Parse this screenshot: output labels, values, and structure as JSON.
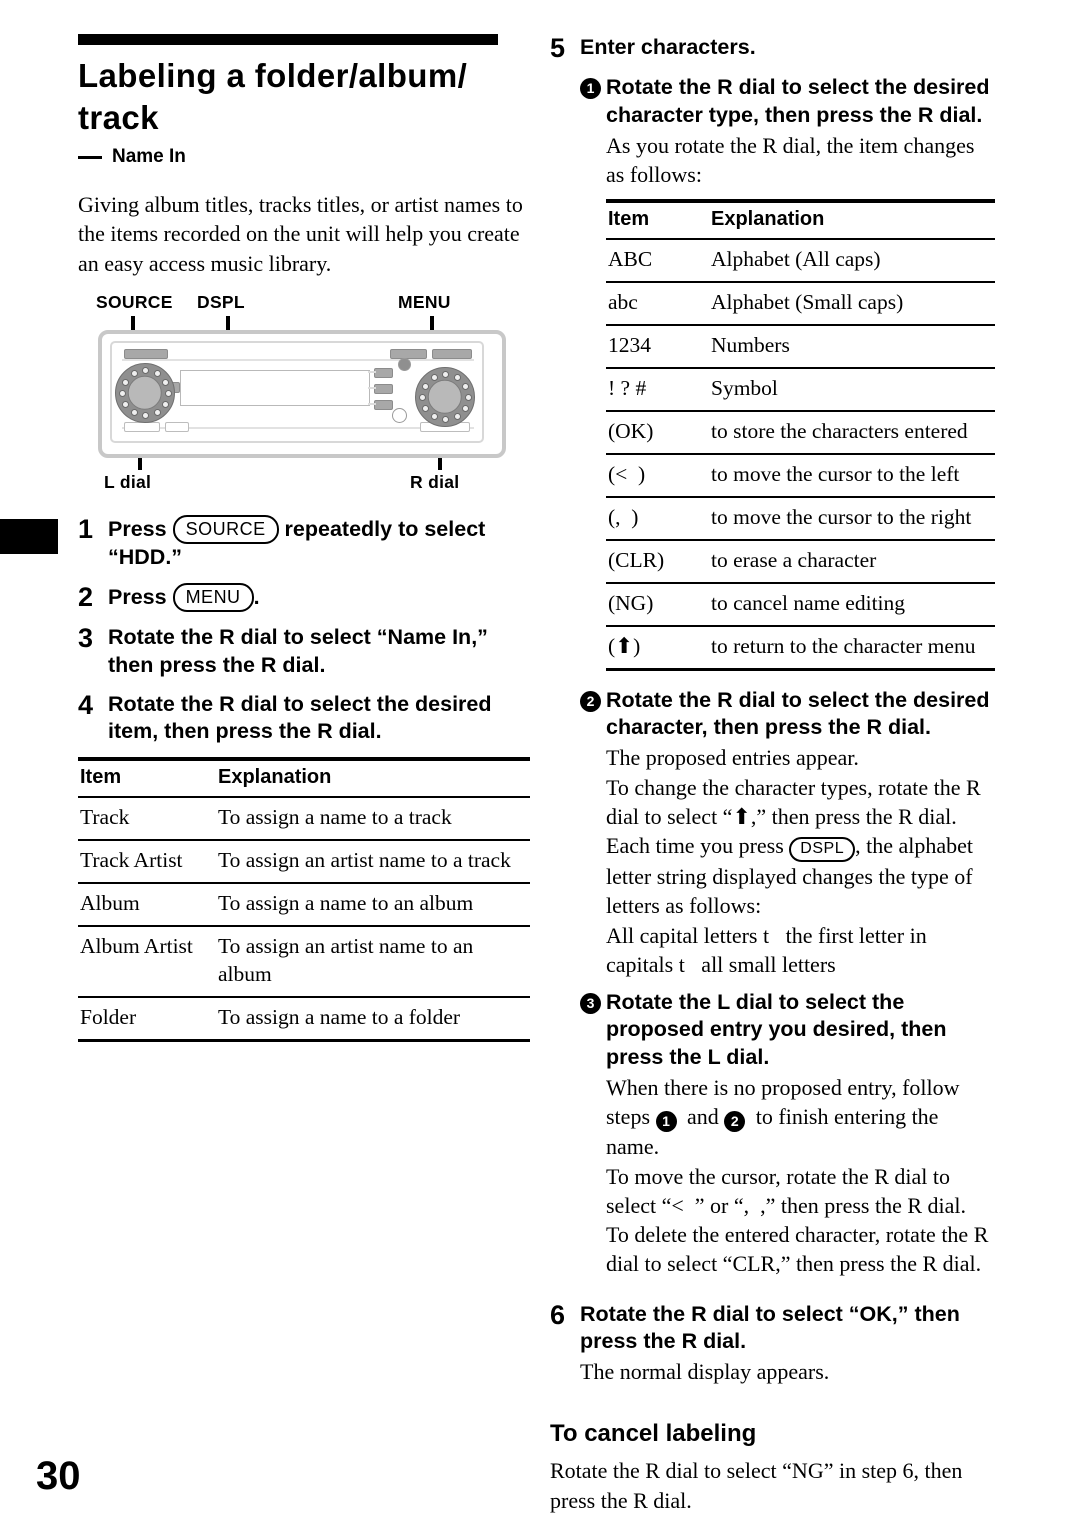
{
  "page": {
    "number": "30"
  },
  "left": {
    "title": "Labeling a folder/album/ track",
    "subhead": "Name In",
    "intro": "Giving album titles, tracks titles, or artist names to the items recorded on the unit will help you create an easy access music library.",
    "diagram": {
      "callouts": {
        "source": "SOURCE",
        "dspl": "DSPL",
        "menu": "MENU",
        "l_dial": "L dial",
        "r_dial": "R dial"
      }
    },
    "steps": [
      {
        "num": "1",
        "before": "Press ",
        "key": "SOURCE",
        "after": " repeatedly to select “HDD.”"
      },
      {
        "num": "2",
        "before": "Press ",
        "key": "MENU",
        "after": "."
      },
      {
        "num": "3",
        "text": "Rotate the R dial to select “Name In,” then press the R dial."
      },
      {
        "num": "4",
        "text": "Rotate the R dial to select the desired item, then press the R dial."
      }
    ],
    "table": {
      "headers": [
        "Item",
        "Explanation"
      ],
      "rows": [
        [
          "Track",
          "To assign a name to a track"
        ],
        [
          "Track Artist",
          "To assign an artist name to a track"
        ],
        [
          "Album",
          "To assign a name to an album"
        ],
        [
          "Album Artist",
          "To assign an artist name to an album"
        ],
        [
          "Folder",
          "To assign a name to a folder"
        ]
      ]
    }
  },
  "right": {
    "step5": {
      "num": "5",
      "title": "Enter characters.",
      "sub1": {
        "marker": "1",
        "title": "Rotate the R dial to select the desired character type, then press the R dial.",
        "body": "As you rotate the R dial, the item changes as follows:"
      },
      "table": {
        "headers": [
          "Item",
          "Explanation"
        ],
        "rows": [
          [
            "ABC",
            "Alphabet (All caps)"
          ],
          [
            "abc",
            "Alphabet (Small caps)"
          ],
          [
            "1234",
            "Numbers"
          ],
          [
            "! ? #",
            "Symbol"
          ],
          [
            "(OK)",
            "to store the characters entered"
          ],
          [
            "(< )",
            "to move the cursor to the left"
          ],
          [
            "(, )",
            "to move the cursor to the right"
          ],
          [
            "(CLR)",
            "to erase a character"
          ],
          [
            "(NG)",
            "to cancel name editing"
          ],
          [
            "(⬆)",
            "to return to the character menu"
          ]
        ]
      },
      "sub2": {
        "marker": "2",
        "title": "Rotate the R dial to select the desired character, then press the R dial.",
        "body_line1": "The proposed entries appear.",
        "body_line2_a": "To change the character types, rotate the R dial to select “",
        "body_line2_glyph": "⬆",
        "body_line2_b": ",” then press the R dial.",
        "body_line3_a": "Each time you press ",
        "body_line3_key": "DSPL",
        "body_line3_b": ", the alphabet letter string displayed changes the type of letters as follows:",
        "body_line4": "All capital letters t  the first letter in capitals t  all small letters"
      },
      "sub3": {
        "marker": "3",
        "title": "Rotate the L dial to select the proposed entry you desired, then press the L dial.",
        "body_line1_a": "When there is no proposed entry, follow steps ",
        "body_line1_m1": "1",
        "body_line1_mid": " and ",
        "body_line1_m2": "2",
        "body_line1_b": " to finish entering the name.",
        "body_line2": "To move the cursor, rotate the R dial to select “< ” or “, ,” then press the R dial.",
        "body_line3": "To delete the entered character, rotate the R dial to select “CLR,” then press the R dial."
      }
    },
    "step6": {
      "num": "6",
      "title": "Rotate the R dial to select “OK,” then press the R dial.",
      "body": "The normal display appears."
    },
    "cancel": {
      "heading": "To cancel labeling",
      "body": "Rotate the R dial to select “NG” in step 6, then press the R dial."
    }
  }
}
